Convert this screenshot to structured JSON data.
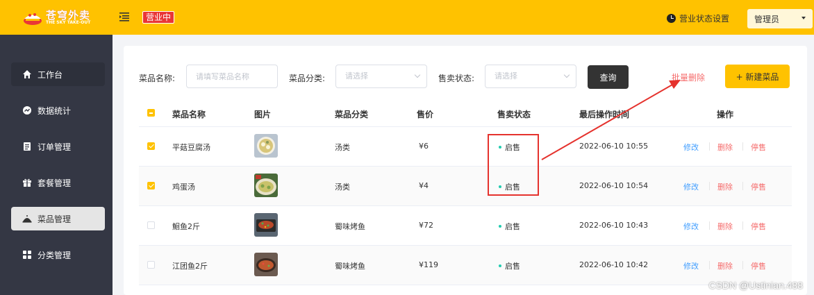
{
  "header": {
    "logo_cn": "苍穹外卖",
    "logo_en": "THE SKY TAKE-OUT",
    "status_tag": "营业中",
    "status_setting": "营业状态设置",
    "admin_label": "管理员"
  },
  "sidebar": {
    "items": [
      {
        "label": "工作台",
        "icon": "home-icon"
      },
      {
        "label": "数据统计",
        "icon": "chart-icon"
      },
      {
        "label": "订单管理",
        "icon": "order-icon"
      },
      {
        "label": "套餐管理",
        "icon": "package-icon"
      },
      {
        "label": "菜品管理",
        "icon": "dish-icon",
        "active": true
      },
      {
        "label": "分类管理",
        "icon": "category-icon"
      }
    ]
  },
  "filters": {
    "name_label": "菜品名称:",
    "name_placeholder": "请填写菜品名称",
    "category_label": "菜品分类:",
    "category_placeholder": "请选择",
    "status_label": "售卖状态:",
    "status_placeholder": "请选择",
    "query_label": "查询",
    "batch_delete_label": "批量删除",
    "new_dish_label": "+ 新建菜品"
  },
  "table": {
    "columns": [
      "菜品名称",
      "图片",
      "菜品分类",
      "售价",
      "售卖状态",
      "最后操作时间",
      "操作"
    ],
    "rows": [
      {
        "name": "平菇豆腐汤",
        "category": "汤类",
        "price": "¥6",
        "status": "启售",
        "time": "2022-06-10 10:55",
        "checked": true
      },
      {
        "name": "鸡蛋汤",
        "category": "汤类",
        "price": "¥4",
        "status": "启售",
        "time": "2022-06-10 10:54",
        "checked": true
      },
      {
        "name": "鮰鱼2斤",
        "category": "蜀味烤鱼",
        "price": "¥72",
        "status": "启售",
        "time": "2022-06-10 10:43",
        "checked": false
      },
      {
        "name": "江团鱼2斤",
        "category": "蜀味烤鱼",
        "price": "¥119",
        "status": "启售",
        "time": "2022-06-10 10:42",
        "checked": false
      }
    ],
    "actions": {
      "edit": "修改",
      "delete": "删除",
      "stop": "停售"
    }
  },
  "colors": {
    "brand": "#ffc200",
    "sidebar": "#343744",
    "danger": "#f56c6c",
    "link": "#419eff",
    "annotation": "#e5322d"
  },
  "watermark": "CSDN @Ustinian.488"
}
